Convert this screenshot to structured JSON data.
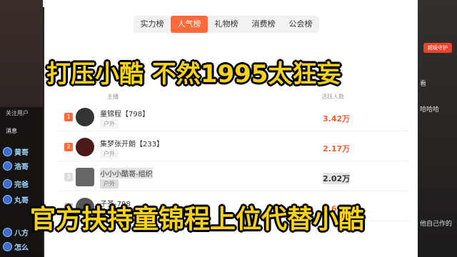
{
  "tabs": [
    "实力榜",
    "人气榜",
    "礼物榜",
    "消费榜",
    "公会榜"
  ],
  "active_tab_index": 1,
  "table": {
    "col_host": "主播",
    "col_count": "活跃人数"
  },
  "rows": [
    {
      "rank": "1",
      "name": "童锦程【798】",
      "tag": "户外",
      "count": "3.42万"
    },
    {
      "rank": "2",
      "name": "集梦张开朗【233】",
      "tag": "户外",
      "count": "2.17万"
    },
    {
      "rank": "3",
      "name": "小小小酷哥-组织",
      "tag": "户外",
      "count": "2.02万"
    },
    {
      "rank": "4",
      "name": "子圣-798",
      "tag": "户外",
      "count": "1.62万"
    }
  ],
  "left_chat": {
    "follow_label": "关注用户",
    "messages_label": "消息",
    "users": [
      "黄哥",
      "浩哥",
      "完爸",
      "丸哥",
      "八方",
      "怎么"
    ]
  },
  "right_chat": {
    "badge": "超级守护",
    "lines": [
      "看",
      "哈哈哈",
      "他自己作的"
    ]
  },
  "captions": {
    "top": "打压小酷 不然1995太狂妄",
    "bottom": "官方扶持童锦程上位代替小酷"
  },
  "colors": {
    "accent": "#ff6a3d",
    "count": "#ff5a2a",
    "caption": "#f6d21c"
  }
}
